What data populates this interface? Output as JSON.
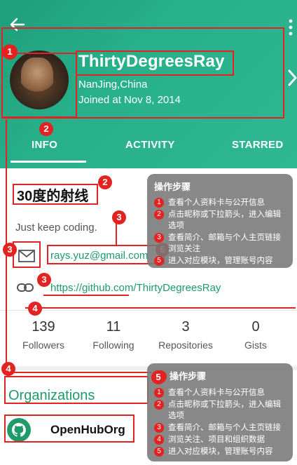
{
  "header": {
    "username": "ThirtyDegreesRay",
    "location": "NanJing,China",
    "joined": "Joined at Nov 8, 2014"
  },
  "tabs": [
    {
      "label": "INFO"
    },
    {
      "label": "ACTIVITY"
    },
    {
      "label": "STARRED"
    }
  ],
  "profile": {
    "display_name": "30度的射线",
    "bio": "Just keep coding.",
    "email": "rays.yuz@gmail.com",
    "blog": "https://github.com/ThirtyDegreesRay"
  },
  "stats": [
    {
      "value": "139",
      "label": "Followers"
    },
    {
      "value": "11",
      "label": "Following"
    },
    {
      "value": "3",
      "label": "Repositories"
    },
    {
      "value": "0",
      "label": "Gists"
    }
  ],
  "organizations": {
    "title": "Organizations",
    "items": [
      {
        "name": "OpenHubOrg"
      }
    ]
  },
  "annotations": {
    "badges": [
      "1",
      "2",
      "2",
      "3",
      "3",
      "3",
      "4",
      "4",
      "5",
      "5"
    ]
  },
  "panel_top": {
    "title": "操作步骤",
    "steps": [
      {
        "n": "1",
        "text": "查看个人资料卡与公开信息"
      },
      {
        "n": "2",
        "text": "点击昵称或下拉箭头，进入编辑选项"
      },
      {
        "n": "3",
        "text": "查看简介、邮箱与个人主页链接浏览关注"
      },
      {
        "n": "5",
        "text": "进入对应模块，管理账号内容"
      }
    ]
  },
  "panel_bottom": {
    "badge": "5",
    "title": "操作步骤",
    "steps": [
      {
        "n": "1",
        "text": "查看个人资料卡与公开信息"
      },
      {
        "n": "2",
        "text": "点击昵称或下拉箭头，进入编辑选项"
      },
      {
        "n": "3",
        "text": "查看简介、邮箱与个人主页链接"
      },
      {
        "n": "4",
        "text": "浏览关注、项目和组织数据"
      },
      {
        "n": "5",
        "text": "进入对应模块，管理账号内容"
      }
    ]
  },
  "colors": {
    "header": "#27b08a",
    "accent": "#1e9a6b",
    "annotation": "#e32222",
    "panel": "#787878"
  }
}
